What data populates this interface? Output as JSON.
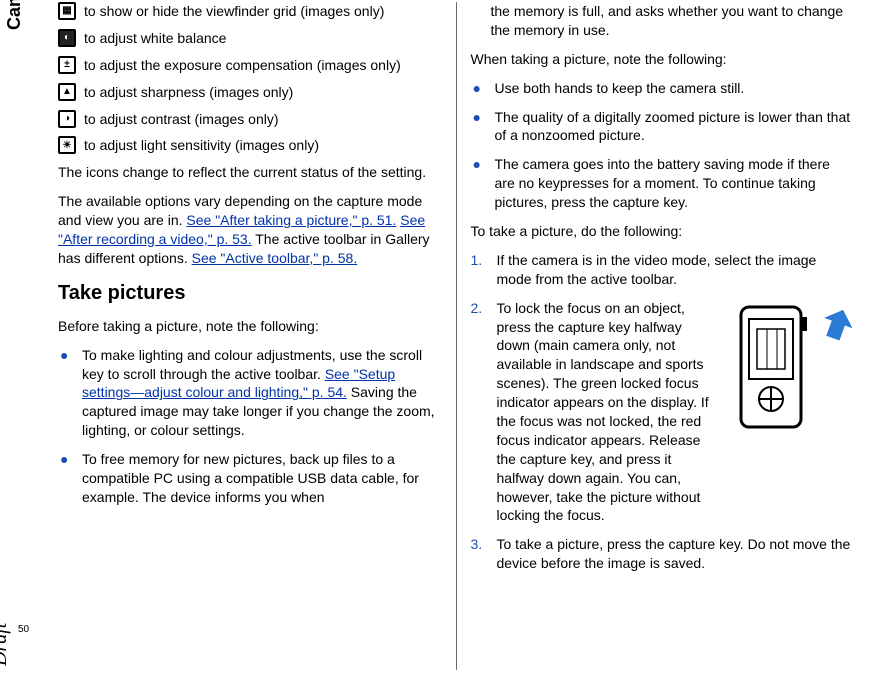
{
  "sideLabel": "Camera",
  "draftLabel": "Draft",
  "pageNumber": "50",
  "col1": {
    "iconItems": [
      {
        "icon": "grid-icon",
        "text": " to show or hide the viewfinder grid (images only)"
      },
      {
        "icon": "white-balance-icon",
        "text": " to adjust white balance"
      },
      {
        "icon": "exposure-icon",
        "text": " to adjust the exposure compensation (images only)"
      },
      {
        "icon": "sharpness-icon",
        "text": " to adjust sharpness (images only)"
      },
      {
        "icon": "contrast-icon",
        "text": " to adjust contrast (images only)"
      },
      {
        "icon": "iso-icon",
        "text": " to adjust light sensitivity (images only)"
      }
    ],
    "para1": "The icons change to reflect the current status of the setting.",
    "para2a": "The available options vary depending on the capture mode and view you are in. ",
    "link1": "See \"After taking a picture,\" p. 51.",
    "link2": "See \"After recording a video,\" p. 53.",
    "para2b": " The active toolbar in Gallery has different options. ",
    "link3": "See \"Active toolbar,\" p. 58.",
    "heading": "Take pictures",
    "para3": "Before taking a picture, note the following:",
    "bullet1a": "To make lighting and colour adjustments, use the scroll key to scroll through the active toolbar. ",
    "bullet1link": "See \"Setup settings—adjust colour and lighting,\" p. 54.",
    "bullet1b": " Saving the captured image may take longer if you change the zoom, lighting, or colour settings.",
    "bullet2": "To free memory for new pictures, back up files to a compatible PC using a compatible USB data cable, for example. The device informs you when"
  },
  "col2": {
    "cont": "the memory is full, and asks whether you want to change the memory in use.",
    "para1": "When taking a picture, note the following:",
    "bullets": [
      "Use both hands to keep the camera still.",
      "The quality of a digitally zoomed picture is lower than that of a nonzoomed picture.",
      "The camera goes into the battery saving mode if there are no keypresses for a moment. To continue taking pictures, press the capture key."
    ],
    "para2": "To take a picture, do the following:",
    "steps": {
      "s1": "If the camera is in the video mode, select the image mode from the active toolbar.",
      "s2": "To lock the focus on an object, press the capture key halfway down (main camera only, not available in landscape and sports scenes). The green locked focus indicator appears on the display. If the focus was not locked, the red focus indicator appears. Release the capture key, and press it halfway down again. You can, however, take the picture without locking the focus.",
      "s3": "To take a picture, press the capture key. Do not move the device before the image is saved."
    }
  }
}
